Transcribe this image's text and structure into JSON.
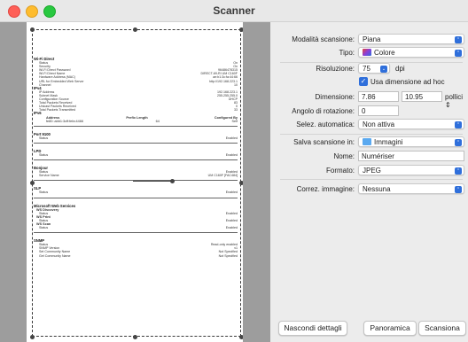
{
  "window": {
    "title": "Scanner"
  },
  "document": {
    "sections": [
      {
        "title": "Wi-Fi Direct",
        "rows": [
          [
            "Status",
            "On"
          ],
          [
            "Security",
            "On"
          ],
          [
            "Wi-Fi Direct Password",
            "96486478315"
          ],
          [
            "Wi-Fi Direct Name",
            "DIRECT-69-RI UM C160F"
          ],
          [
            "Hardware Address (MAC)",
            "ae:b1:3c:fa:44:66"
          ],
          [
            "URL for Embedded Web Server",
            "http://192.168.223.1"
          ],
          [
            "Channel",
            "10"
          ]
        ]
      },
      {
        "title": "IPv4",
        "rows": [
          [
            "IP Address",
            "192.168.223.1"
          ],
          [
            "Subnet Mask",
            "255.255.255.0"
          ],
          [
            "Configuration Source",
            "DHCP"
          ],
          [
            "Total Packets Received",
            "83"
          ],
          [
            "Unicast Packets Received",
            "0"
          ],
          [
            "Total Packets Transmitted",
            "33"
          ]
        ]
      },
      {
        "title": "IPv6",
        "header": [
          "Address",
          "Prefix Length",
          "Configured By"
        ],
        "row": [
          "fe80::abb1:3cff:fefa:4466",
          "64",
          "Self"
        ]
      },
      {
        "title": "Port 9100",
        "rows": [
          [
            "Status",
            "Enabled"
          ]
        ]
      },
      {
        "title": "LPD",
        "rows": [
          [
            "Status",
            "Enabled"
          ]
        ]
      },
      {
        "title": "Bonjour",
        "rows": [
          [
            "Status",
            "Enabled"
          ],
          [
            "Service Name",
            "UM C160F [FAC484]"
          ]
        ]
      },
      {
        "title": "SLP",
        "rows": [
          [
            "Status",
            "Enabled"
          ]
        ]
      },
      {
        "title": "Microsoft Web Services",
        "subs": [
          {
            "title": "WS Discovery",
            "rows": [
              [
                "Status",
                "Enabled"
              ]
            ]
          },
          {
            "title": "WS Print",
            "rows": [
              [
                "Status",
                "Enabled"
              ]
            ]
          },
          {
            "title": "WS Scan",
            "rows": [
              [
                "Status",
                "Enabled"
              ]
            ]
          }
        ]
      },
      {
        "title": "SNMP",
        "rows": [
          [
            "Status",
            "Read-only enabled"
          ],
          [
            "SNMP Version",
            "v1"
          ],
          [
            "Set Community Name",
            "Not Specified"
          ],
          [
            "Get Community Name",
            "Not Specified"
          ]
        ]
      }
    ]
  },
  "panel": {
    "mode_label": "Modalità scansione:",
    "mode_value": "Piana",
    "type_label": "Tipo:",
    "type_value": "Colore",
    "resolution_label": "Risoluzione:",
    "resolution_value": "75",
    "resolution_unit": "dpi",
    "custom_size_label": "Usa dimensione ad hoc",
    "dimension_label": "Dimensione:",
    "width_value": "7.86",
    "height_value": "10.95",
    "dimension_unit": "pollici",
    "rotation_label": "Angolo di rotazione:",
    "rotation_value": "0",
    "autoselect_label": "Selez. automatica:",
    "autoselect_value": "Non attiva",
    "save_label": "Salva scansione in:",
    "save_value": "Immagini",
    "name_label": "Nome:",
    "name_value": "Numériser",
    "format_label": "Formato:",
    "format_value": "JPEG",
    "correction_label": "Correz. immagine:",
    "correction_value": "Nessuna"
  },
  "buttons": {
    "hide_details": "Nascondi dettagli",
    "overview": "Panoramica",
    "scan": "Scansiona"
  },
  "colors": {
    "accent": "#2f6fdb",
    "folder": "#5aa9f0"
  }
}
